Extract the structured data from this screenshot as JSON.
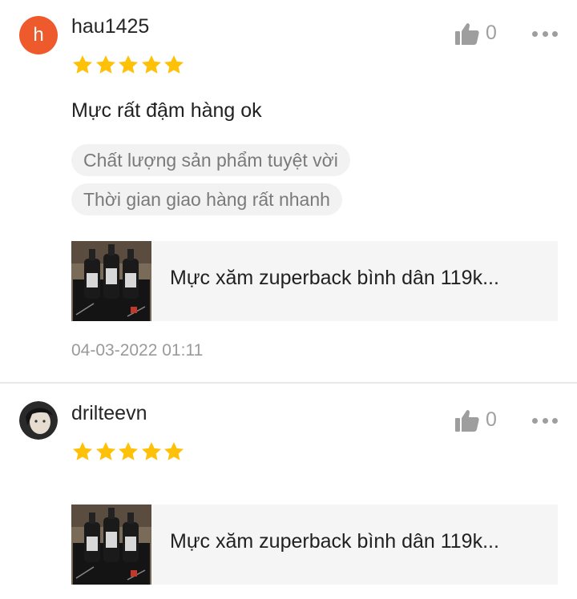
{
  "colors": {
    "star": "#ffc107",
    "avatar_letter_bg": "#ef5a2c",
    "tag_bg": "#f2f2f2",
    "product_bg": "#f5f5f5",
    "muted_text": "#9a9a9a"
  },
  "reviews": [
    {
      "avatar_letter": "h",
      "username": "hau1425",
      "rating": 5,
      "like_count": "0",
      "comment": "Mực rất đậm hàng ok",
      "tags": [
        "Chất lượng sản phẩm tuyệt vời",
        "Thời gian giao hàng rất nhanh"
      ],
      "product_name": "Mực xăm zuperback bình dân 119k...",
      "timestamp": "04-03-2022 01:11"
    },
    {
      "avatar_icon": "user-photo",
      "username": "drilteevn",
      "rating": 5,
      "like_count": "0",
      "product_name": "Mực xăm zuperback bình dân 119k..."
    }
  ]
}
